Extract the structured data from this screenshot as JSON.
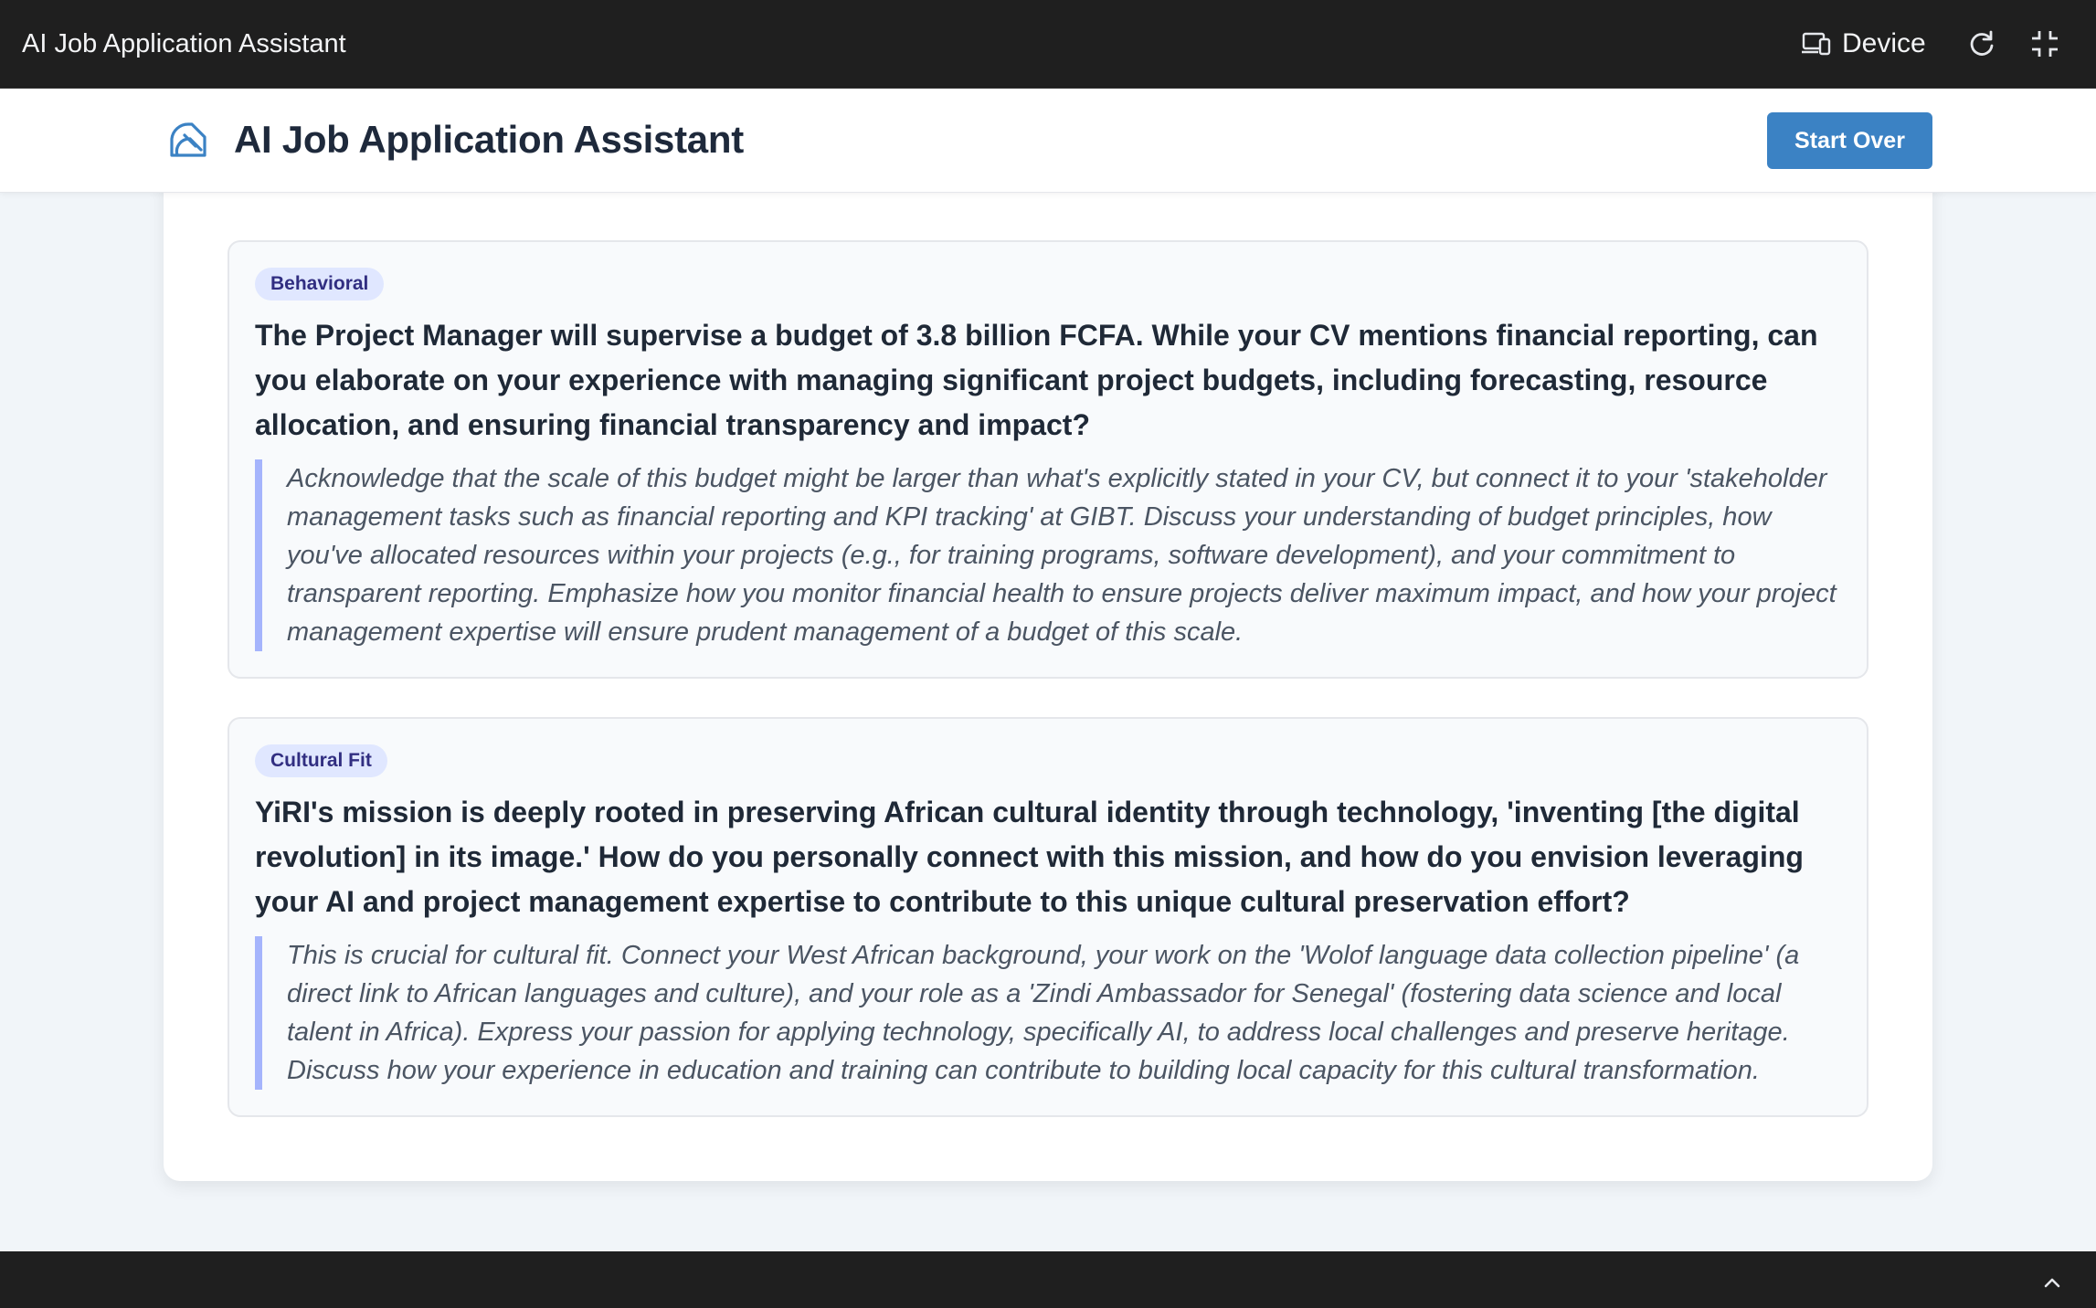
{
  "window": {
    "title": "AI Job Application Assistant",
    "device_label": "Device",
    "icons": [
      "device-icon",
      "refresh-icon",
      "collapse-icon",
      "chevron-up-icon"
    ]
  },
  "header": {
    "title": "AI Job Application Assistant",
    "logo_icon": "logo-icon",
    "start_over_label": "Start Over",
    "accent_color": "#3b82c4"
  },
  "questions": [
    {
      "tag": "Behavioral",
      "question": "The Project Manager will supervise a budget of 3.8 billion FCFA. While your CV mentions financial reporting, can you elaborate on your experience with managing significant project budgets, including forecasting, resource allocation, and ensuring financial transparency and impact?",
      "guidance": "Acknowledge that the scale of this budget might be larger than what's explicitly stated in your CV, but connect it to your 'stakeholder management tasks such as financial reporting and KPI tracking' at GIBT. Discuss your understanding of budget principles, how you've allocated resources within your projects (e.g., for training programs, software development), and your commitment to transparent reporting. Emphasize how you monitor financial health to ensure projects deliver maximum impact, and how your project management expertise will ensure prudent management of a budget of this scale."
    },
    {
      "tag": "Cultural Fit",
      "question": "YiRI's mission is deeply rooted in preserving African cultural identity through technology, 'inventing [the digital revolution] in its image.' How do you personally connect with this mission, and how do you envision leveraging your AI and project management expertise to contribute to this unique cultural preservation effort?",
      "guidance": "This is crucial for cultural fit. Connect your West African background, your work on the 'Wolof language data collection pipeline' (a direct link to African languages and culture), and your role as a 'Zindi Ambassador for Senegal' (fostering data science and local talent in Africa). Express your passion for applying technology, specifically AI, to address local challenges and preserve heritage. Discuss how your experience in education and training can contribute to building local capacity for this cultural transformation."
    }
  ]
}
